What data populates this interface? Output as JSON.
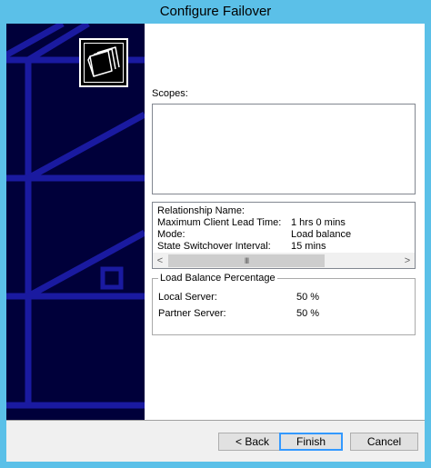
{
  "window": {
    "title": "Configure Failover"
  },
  "scopes": {
    "label": "Scopes:"
  },
  "relationship": {
    "rows": [
      {
        "label": "Relationship Name:",
        "value": ""
      },
      {
        "label": "Maximum Client Lead Time:",
        "value": "1 hrs 0 mins"
      },
      {
        "label": "Mode:",
        "value": "Load balance"
      },
      {
        "label": "State Switchover Interval:",
        "value": "15 mins"
      }
    ],
    "scroll_left": "<",
    "scroll_right": ">",
    "scroll_thumb": "III"
  },
  "load_balance": {
    "title": "Load Balance Percentage",
    "local_label": "Local Server:",
    "local_value": "50 %",
    "partner_label": "Partner Server:",
    "partner_value": "50 %"
  },
  "buttons": {
    "back": "< Back",
    "finish": "Finish",
    "cancel": "Cancel"
  },
  "colors": {
    "sidebar": "#00003a",
    "sidebar_accent": "#1a1aa0",
    "titlebar": "#5bc0e8",
    "default_button": "#3399ff"
  },
  "icons": {
    "wizard": "folders-icon"
  }
}
